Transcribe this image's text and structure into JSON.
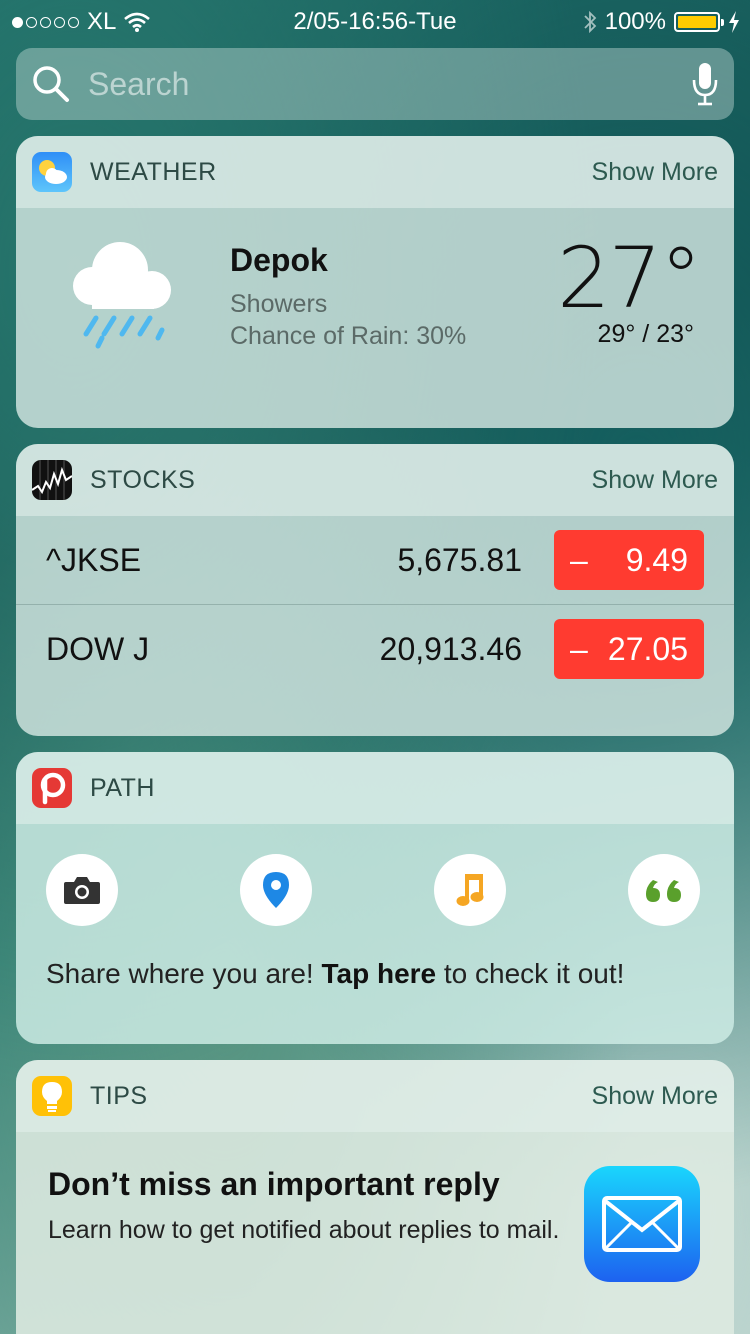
{
  "status_bar": {
    "carrier": "XL",
    "datetime": "2/05-16:56-Tue",
    "battery": "100%",
    "signal_bars": 1,
    "battery_color": "#ffcc00"
  },
  "search": {
    "placeholder": "Search"
  },
  "weather": {
    "title": "WEATHER",
    "show_more": "Show More",
    "city": "Depok",
    "condition": "Showers",
    "rain_chance": "Chance of Rain: 30%",
    "temperature": "27°",
    "high_low": "29° / 23°",
    "icon": "rain-cloud-icon"
  },
  "stocks": {
    "title": "STOCKS",
    "show_more": "Show More",
    "rows": [
      {
        "symbol": "^JKSE",
        "price": "5,675.81",
        "sign": "–",
        "change": "9.49"
      },
      {
        "symbol": "DOW J",
        "price": "20,913.46",
        "sign": "–",
        "change": "27.05"
      }
    ],
    "negative_color": "#ff3b30"
  },
  "path": {
    "title": "PATH",
    "text_before": "Share where you are! ",
    "text_bold": "Tap here",
    "text_after": " to check it out!",
    "actions": [
      "camera-icon",
      "location-pin-icon",
      "music-note-icon",
      "quote-icon"
    ],
    "brand_color": "#e53935"
  },
  "tips": {
    "title": "TIPS",
    "show_more": "Show More",
    "headline": "Don’t miss an important reply",
    "description": "Learn how to get notified about replies to mail."
  }
}
